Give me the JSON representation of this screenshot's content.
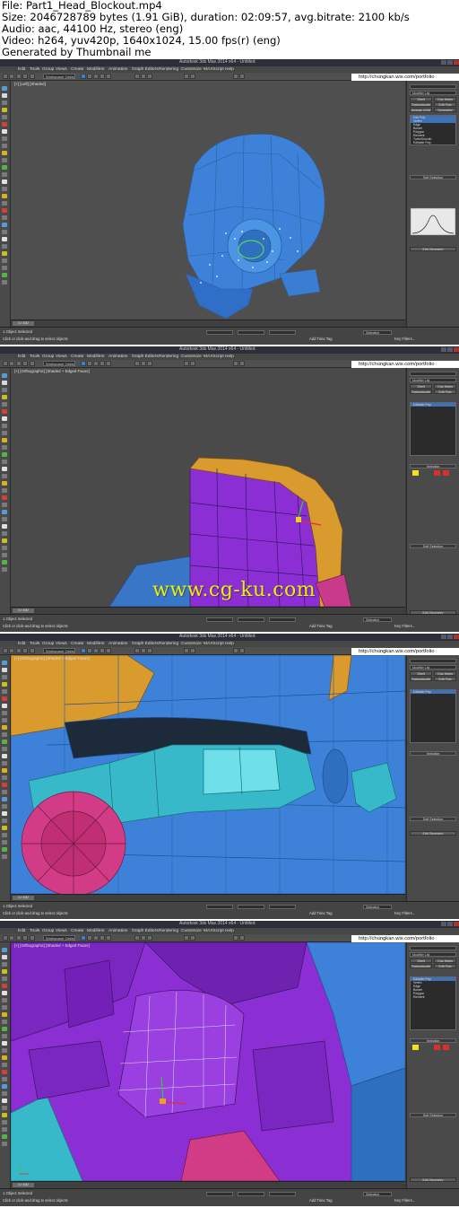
{
  "header_lines": [
    "File: Part1_Head_Blockout.mp4",
    "Size: 2046728789 bytes (1.91 GiB), duration: 02:09:57, avg.bitrate: 2100 kb/s",
    "Audio: aac, 44100 Hz, stereo (eng)",
    "Video: h264, yuv420p, 1640x1024, 15.00 fps(r) (eng)",
    "Generated by Thumbnail me"
  ],
  "app": {
    "menu": [
      "Edit",
      "Tools",
      "Group",
      "Views",
      "Create",
      "Modifiers",
      "Animation",
      "Graph Editors",
      "Rendering",
      "Customize",
      "MAXScript",
      "Help"
    ],
    "workspace": "Workspace: Default",
    "url": "http://chungkan.wix.com/portfolio",
    "modifier_list": "Modifier List",
    "modifier_buttons": [
      "Shell",
      "Cap Holes",
      "Turbosmooth",
      "Edit Poly",
      "Unwrap UVW",
      "Symmetry",
      "UVW Map"
    ],
    "stack_items": [
      "Edit Poly",
      "Vertex",
      "Edge",
      "Border",
      "Polygon",
      "Element",
      "TurboSmooth",
      "Editable Poly"
    ],
    "soft_selection": "Soft Selection",
    "selection": "Selection",
    "edit_geometry": "Edit Geometry",
    "status_selected": "1 Object Selected",
    "status_hint": "Click or click-and-drag to select objects",
    "add_time_tag": "Add Time Tag",
    "selected_label": "Selected",
    "key_filters": "Key Filters...",
    "time_slider": "0 / 100"
  },
  "frames": [
    {
      "viewport_label": "[+] [Left] [Shaded]",
      "title": "Autodesk 3ds Max 2014 x64 - Untitled"
    },
    {
      "viewport_label": "[+] [Orthographic] [Shaded + Edged Faces]",
      "title": "Autodesk 3ds Max 2014 x64 - Untitled"
    },
    {
      "viewport_label": "[+] [Orthographic] [Shaded + Edged Faces]",
      "title": "Autodesk 3ds Max 2014 x64 - Untitled"
    },
    {
      "viewport_label": "[+] [Orthographic] [Shaded + Edged Faces]",
      "title": "Autodesk 3ds Max 2014 x64 - Untitled"
    }
  ],
  "watermark": "www.cg-ku.com",
  "colors": {
    "mesh_blue": "#3d82d8",
    "mesh_purple": "#8b2fd4",
    "mesh_orange": "#d99a2e",
    "mesh_cyan": "#37b9c9",
    "mesh_magenta": "#d23c86",
    "watermark": "#e8f000"
  }
}
